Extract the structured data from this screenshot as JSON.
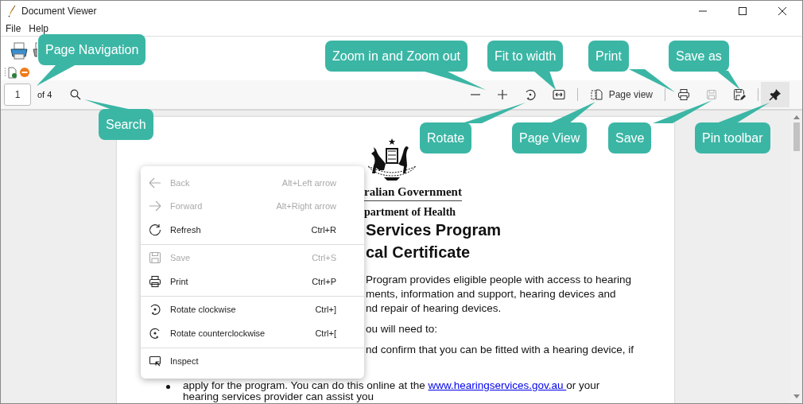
{
  "window": {
    "title": "Document Viewer"
  },
  "menu": [
    "File",
    "Help"
  ],
  "page_nav": {
    "page": "1",
    "total": "of 4"
  },
  "toolbar": {
    "page_view": "Page view",
    "save_disabled": true,
    "pinned": true
  },
  "callouts": [
    {
      "label": "Page Navigation"
    },
    {
      "label": "Search"
    },
    {
      "label": "Zoom in and Zoom out"
    },
    {
      "label": "Fit to width"
    },
    {
      "label": "Print"
    },
    {
      "label": "Save as"
    },
    {
      "label": "Rotate"
    },
    {
      "label": "Page View"
    },
    {
      "label": "Save"
    },
    {
      "label": "Pin toolbar"
    }
  ],
  "document": {
    "agency": "ralian Government",
    "department": "partment of Health",
    "headings": [
      "Services Program",
      "cal Certificate"
    ],
    "paragraph": [
      "Program provides eligible people with access to hearing",
      "ments, information and support, hearing devices and",
      "nd repair of hearing devices."
    ],
    "lead": "ou will need to:",
    "item_line": "nd confirm that you can be fitted with a hearing device, if",
    "bullet": {
      "before": "apply for the program. You can do this online at the ",
      "link": "www.hearingservices.gov.au ",
      "after": "or your",
      "next_line": "hearing services provider can assist you"
    }
  },
  "context_menu": [
    {
      "items": [
        {
          "label": "Back",
          "shortcut": "Alt+Left arrow",
          "disabled": true
        },
        {
          "label": "Forward",
          "shortcut": "Alt+Right arrow",
          "disabled": true
        },
        {
          "label": "Refresh",
          "shortcut": "Ctrl+R",
          "disabled": false
        }
      ]
    },
    {
      "items": [
        {
          "label": "Save",
          "shortcut": "Ctrl+S",
          "disabled": true
        },
        {
          "label": "Print",
          "shortcut": "Ctrl+P",
          "disabled": false
        }
      ]
    },
    {
      "items": [
        {
          "label": "Rotate clockwise",
          "shortcut": "Ctrl+]",
          "disabled": false
        },
        {
          "label": "Rotate counterclockwise",
          "shortcut": "Ctrl+[",
          "disabled": false
        }
      ]
    },
    {
      "items": [
        {
          "label": "Inspect",
          "disabled": false
        }
      ]
    }
  ]
}
